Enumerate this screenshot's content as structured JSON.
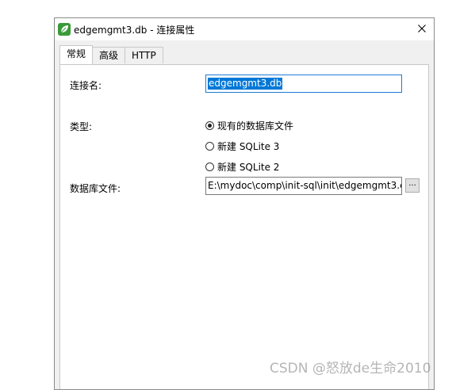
{
  "window": {
    "title": "edgemgmt3.db - 连接属性"
  },
  "tabs": [
    {
      "label": "常规",
      "active": true
    },
    {
      "label": "高级",
      "active": false
    },
    {
      "label": "HTTP",
      "active": false
    }
  ],
  "form": {
    "connection_name_label": "连接名:",
    "connection_name_value": "edgemgmt3.db",
    "type_label": "类型:",
    "type_options": [
      {
        "label": "现有的数据库文件",
        "checked": true
      },
      {
        "label": "新建 SQLite 3",
        "checked": false
      },
      {
        "label": "新建 SQLite 2",
        "checked": false
      }
    ],
    "db_file_label": "数据库文件:",
    "db_file_value": "E:\\mydoc\\comp\\init-sql\\init\\edgemgmt3.c",
    "browse_label": "..."
  },
  "watermark": "CSDN @怒放de生命2010",
  "icons": {
    "app": "leaf-icon",
    "close": "close-icon"
  },
  "colors": {
    "selection": "#0078d7",
    "app_icon": "#3a9a3a",
    "focus_border": "#1e7bd6"
  }
}
